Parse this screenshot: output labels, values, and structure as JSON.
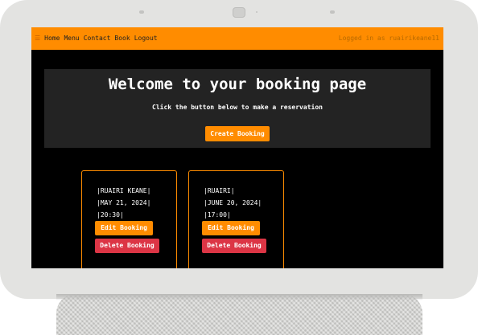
{
  "nav": {
    "icon": "hamburger-icon",
    "links": [
      "Home",
      "Menu",
      "Contact",
      "Book",
      "Logout"
    ],
    "status": "Logged in as ruairikeane11"
  },
  "hero": {
    "title": "Welcome to your booking page",
    "subtitle": "Click the button below to make a reservation",
    "create_button": "Create Booking"
  },
  "bookings": [
    {
      "name": "|RUAIRI KEANE|",
      "date": "|MAY 21, 2024|",
      "time": "|20:30|",
      "edit_label": "Edit Booking",
      "delete_label": "Delete Booking"
    },
    {
      "name": "|RUAIRI|",
      "date": "|JUNE 20, 2024|",
      "time": "|17:00|",
      "edit_label": "Edit Booking",
      "delete_label": "Delete Booking"
    }
  ],
  "colors": {
    "accent": "#ff8c00",
    "danger": "#dc3545",
    "background": "#000000",
    "panel": "#232323"
  }
}
